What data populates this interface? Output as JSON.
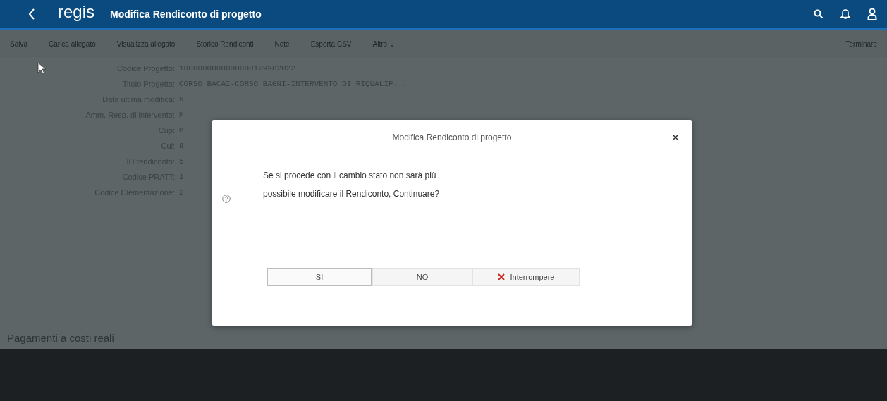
{
  "header": {
    "logo": "regis",
    "title": "Modifica Rendiconto di progetto"
  },
  "toolbar": {
    "items": [
      "Salva",
      "Carica allegato",
      "Visualizza allegato",
      "Storico Rendiconti",
      "Note",
      "Esporta CSV",
      "Altro ⌄"
    ],
    "right": "Terminare"
  },
  "fields": [
    {
      "label": "Codice Progetto:",
      "value": "1000000000000000129982022"
    },
    {
      "label": "Titolo Progetto:",
      "value": "CORSO BACAI-CORSO BAGNI-INTERVENTO DI RIQUALIF..."
    },
    {
      "label": "Data ultima modifica:",
      "value": "9"
    },
    {
      "label": "Amm. Resp. di intervento:",
      "value": "M"
    },
    {
      "label": "Cup:",
      "value": "M"
    },
    {
      "label": "Cui:",
      "value": "8"
    },
    {
      "label": "ID rendiconto:",
      "value": "5"
    },
    {
      "label": "Codice PRATT:",
      "value": "1"
    },
    {
      "label": "Codice Clementazione:",
      "value": "2"
    }
  ],
  "section_title": "Pagamenti a costi reali",
  "dialog": {
    "title": "Modifica Rendiconto di progetto",
    "message_lines": [
      "Se si procede con il cambio stato non sarà più",
      "possibile modificare il Rendiconto, Continuare?"
    ],
    "buttons": [
      {
        "label": "SI",
        "kind": "plain",
        "selected": true
      },
      {
        "label": "NO",
        "kind": "plain",
        "selected": false
      },
      {
        "label": "Interrompere",
        "kind": "cancel",
        "selected": false
      }
    ]
  }
}
